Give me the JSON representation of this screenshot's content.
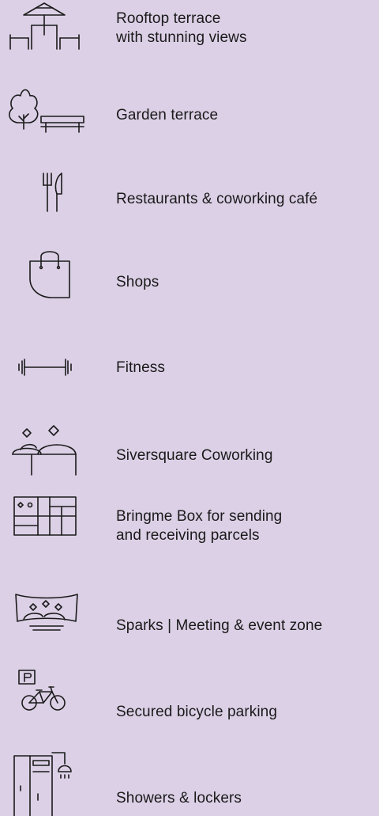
{
  "theme": {
    "background": "#dcd0e6",
    "text": "#1a1a1a"
  },
  "amenities": [
    {
      "icon": "rooftop-terrace-icon",
      "lines": [
        "Rooftop terrace",
        "with stunning views"
      ]
    },
    {
      "icon": "garden-terrace-icon",
      "lines": [
        "Garden terrace"
      ]
    },
    {
      "icon": "fork-knife-icon",
      "lines": [
        "Restaurants & coworking café"
      ]
    },
    {
      "icon": "shopping-bag-icon",
      "lines": [
        "Shops"
      ]
    },
    {
      "icon": "dumbbell-icon",
      "lines": [
        "Fitness"
      ]
    },
    {
      "icon": "coworking-people-icon",
      "lines": [
        "Siversquare Coworking"
      ]
    },
    {
      "icon": "parcel-lockers-icon",
      "lines": [
        "Bringme Box for sending",
        "and receiving parcels"
      ]
    },
    {
      "icon": "meeting-screen-icon",
      "lines": [
        "Sparks | Meeting & event zone"
      ]
    },
    {
      "icon": "bicycle-parking-icon",
      "lines": [
        "Secured bicycle parking"
      ]
    },
    {
      "icon": "showers-lockers-icon",
      "lines": [
        "Showers & lockers"
      ]
    }
  ]
}
